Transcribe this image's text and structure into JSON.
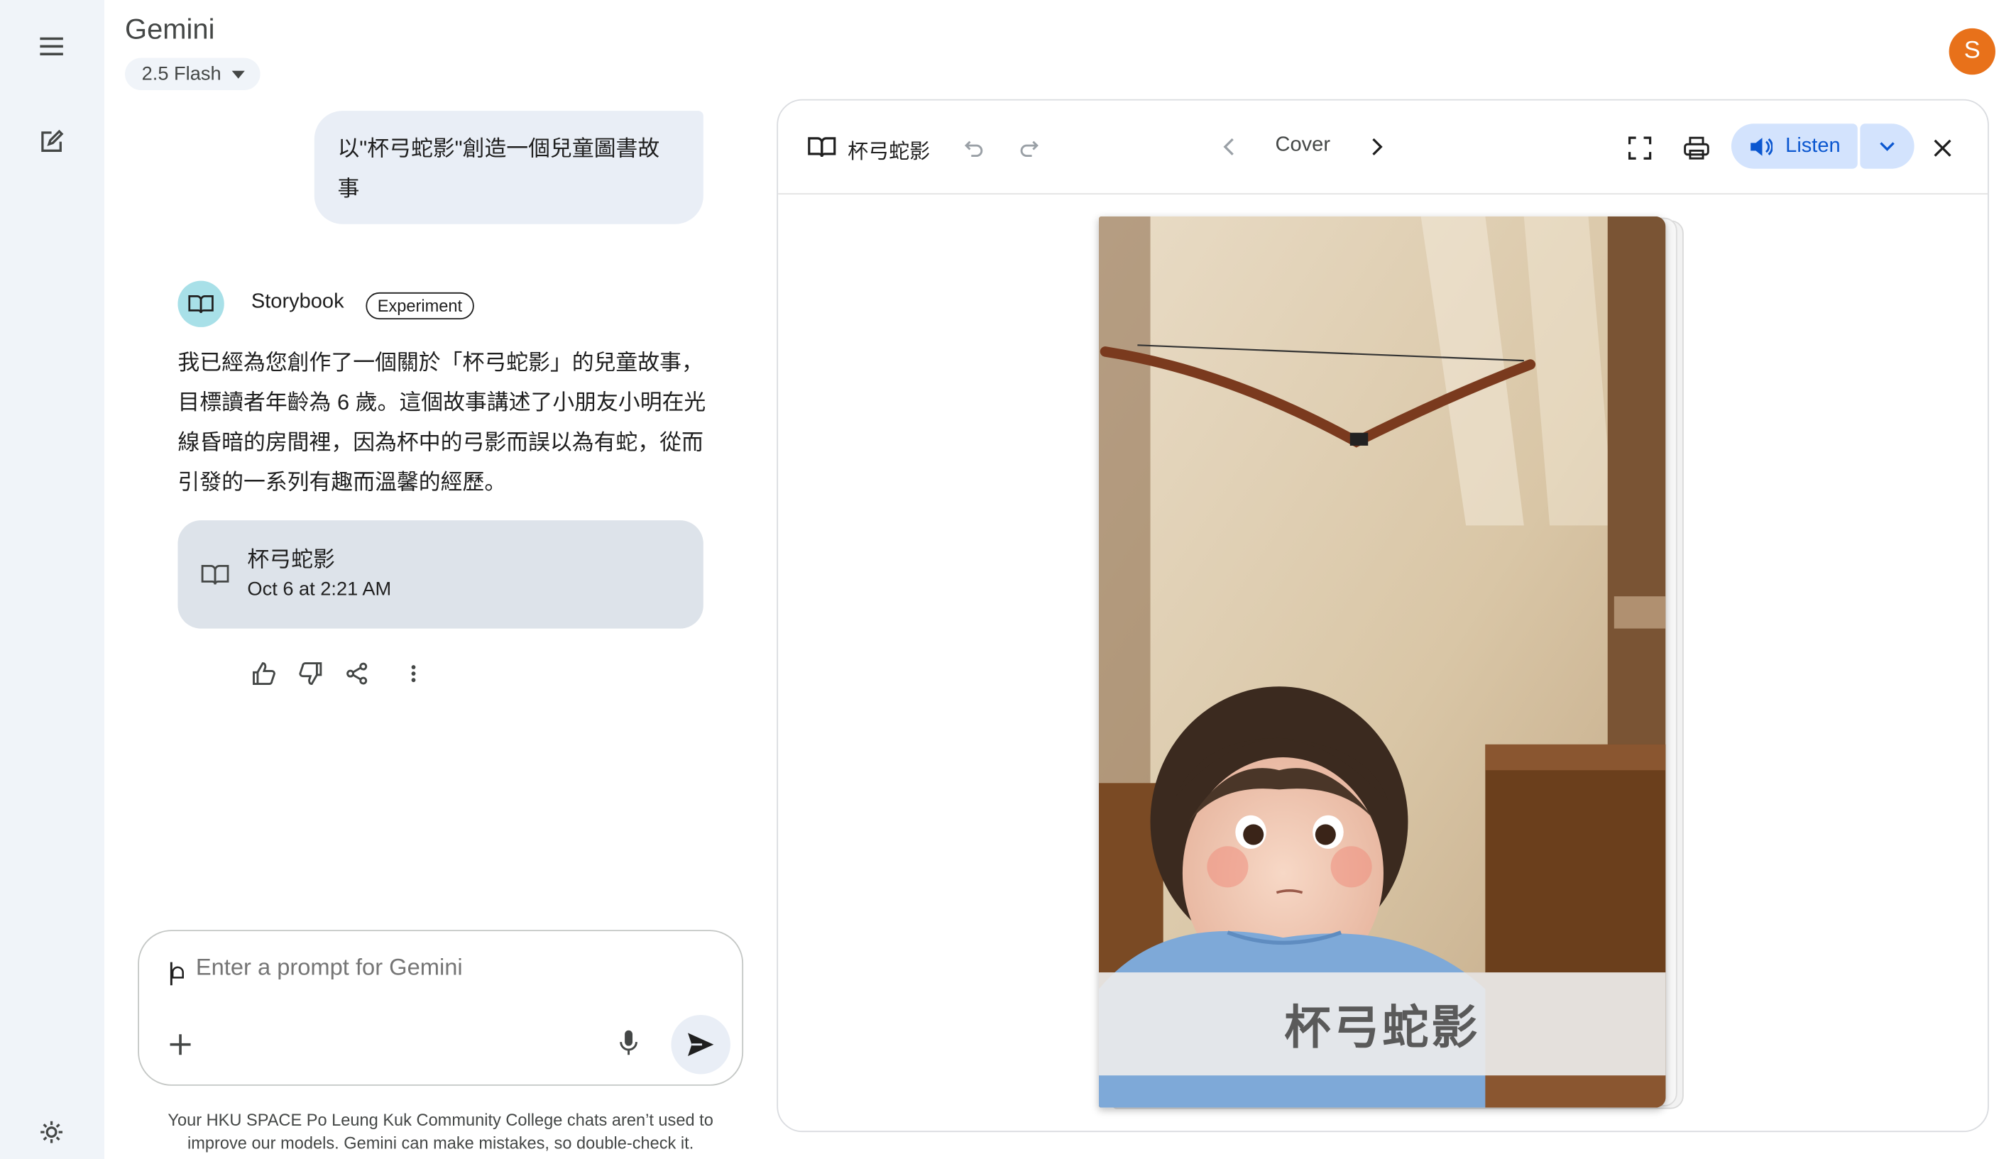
{
  "app": {
    "title": "Gemini",
    "model": "2.5 Flash",
    "avatar_letter": "S",
    "avatar_color": "#e8711a"
  },
  "rail": {
    "icons": [
      "menu-icon",
      "new-chat-icon",
      "settings-icon"
    ]
  },
  "chat": {
    "user_message": "以\"杯弓蛇影\"創造一個兒童圖書故事",
    "agent_name": "Storybook",
    "agent_badge": "Experiment",
    "response_text": "我已經為您創作了一個關於「杯弓蛇影」的兒童故事，目標讀者年齡為 6 歲。這個故事講述了小朋友小明在光線昏暗的房間裡，因為杯中的弓影而誤以為有蛇，從而引發的一系列有趣而溫馨的經歷。",
    "card": {
      "title": "杯弓蛇影",
      "date": "Oct 6 at 2:21 AM"
    },
    "actions": [
      "thumbs-up-icon",
      "thumbs-down-icon",
      "share-icon",
      "more-vert-icon"
    ]
  },
  "prompt": {
    "placeholder": "Enter a prompt for Gemini",
    "disclaimer": "Your HKU SPACE Po Leung Kuk Community College chats aren’t used to improve our models. Gemini can make mistakes, so double-check it."
  },
  "storybook": {
    "title": "杯弓蛇影",
    "page_label": "Cover",
    "listen_label": "Listen",
    "cover_title": "杯弓蛇影",
    "accent": "#0b57d0",
    "accent_bg": "#d3e3fd"
  }
}
